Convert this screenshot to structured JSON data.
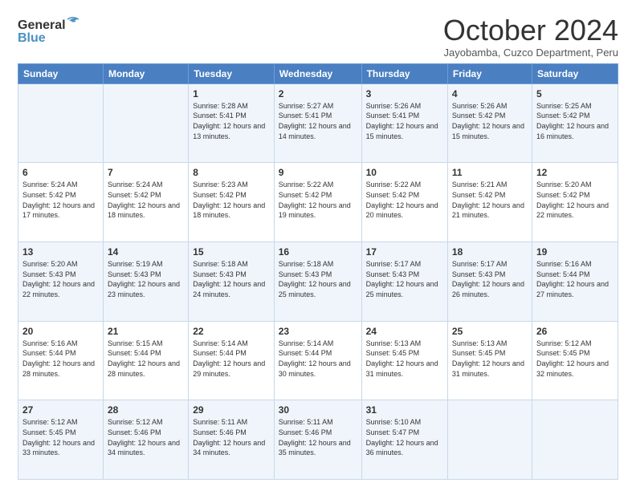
{
  "logo": {
    "line1": "General",
    "line2": "Blue"
  },
  "title": "October 2024",
  "location": "Jayobamba, Cuzco Department, Peru",
  "days_of_week": [
    "Sunday",
    "Monday",
    "Tuesday",
    "Wednesday",
    "Thursday",
    "Friday",
    "Saturday"
  ],
  "weeks": [
    [
      {
        "num": "",
        "info": ""
      },
      {
        "num": "",
        "info": ""
      },
      {
        "num": "1",
        "info": "Sunrise: 5:28 AM\nSunset: 5:41 PM\nDaylight: 12 hours and 13 minutes."
      },
      {
        "num": "2",
        "info": "Sunrise: 5:27 AM\nSunset: 5:41 PM\nDaylight: 12 hours and 14 minutes."
      },
      {
        "num": "3",
        "info": "Sunrise: 5:26 AM\nSunset: 5:41 PM\nDaylight: 12 hours and 15 minutes."
      },
      {
        "num": "4",
        "info": "Sunrise: 5:26 AM\nSunset: 5:42 PM\nDaylight: 12 hours and 15 minutes."
      },
      {
        "num": "5",
        "info": "Sunrise: 5:25 AM\nSunset: 5:42 PM\nDaylight: 12 hours and 16 minutes."
      }
    ],
    [
      {
        "num": "6",
        "info": "Sunrise: 5:24 AM\nSunset: 5:42 PM\nDaylight: 12 hours and 17 minutes."
      },
      {
        "num": "7",
        "info": "Sunrise: 5:24 AM\nSunset: 5:42 PM\nDaylight: 12 hours and 18 minutes."
      },
      {
        "num": "8",
        "info": "Sunrise: 5:23 AM\nSunset: 5:42 PM\nDaylight: 12 hours and 18 minutes."
      },
      {
        "num": "9",
        "info": "Sunrise: 5:22 AM\nSunset: 5:42 PM\nDaylight: 12 hours and 19 minutes."
      },
      {
        "num": "10",
        "info": "Sunrise: 5:22 AM\nSunset: 5:42 PM\nDaylight: 12 hours and 20 minutes."
      },
      {
        "num": "11",
        "info": "Sunrise: 5:21 AM\nSunset: 5:42 PM\nDaylight: 12 hours and 21 minutes."
      },
      {
        "num": "12",
        "info": "Sunrise: 5:20 AM\nSunset: 5:42 PM\nDaylight: 12 hours and 22 minutes."
      }
    ],
    [
      {
        "num": "13",
        "info": "Sunrise: 5:20 AM\nSunset: 5:43 PM\nDaylight: 12 hours and 22 minutes."
      },
      {
        "num": "14",
        "info": "Sunrise: 5:19 AM\nSunset: 5:43 PM\nDaylight: 12 hours and 23 minutes."
      },
      {
        "num": "15",
        "info": "Sunrise: 5:18 AM\nSunset: 5:43 PM\nDaylight: 12 hours and 24 minutes."
      },
      {
        "num": "16",
        "info": "Sunrise: 5:18 AM\nSunset: 5:43 PM\nDaylight: 12 hours and 25 minutes."
      },
      {
        "num": "17",
        "info": "Sunrise: 5:17 AM\nSunset: 5:43 PM\nDaylight: 12 hours and 25 minutes."
      },
      {
        "num": "18",
        "info": "Sunrise: 5:17 AM\nSunset: 5:43 PM\nDaylight: 12 hours and 26 minutes."
      },
      {
        "num": "19",
        "info": "Sunrise: 5:16 AM\nSunset: 5:44 PM\nDaylight: 12 hours and 27 minutes."
      }
    ],
    [
      {
        "num": "20",
        "info": "Sunrise: 5:16 AM\nSunset: 5:44 PM\nDaylight: 12 hours and 28 minutes."
      },
      {
        "num": "21",
        "info": "Sunrise: 5:15 AM\nSunset: 5:44 PM\nDaylight: 12 hours and 28 minutes."
      },
      {
        "num": "22",
        "info": "Sunrise: 5:14 AM\nSunset: 5:44 PM\nDaylight: 12 hours and 29 minutes."
      },
      {
        "num": "23",
        "info": "Sunrise: 5:14 AM\nSunset: 5:44 PM\nDaylight: 12 hours and 30 minutes."
      },
      {
        "num": "24",
        "info": "Sunrise: 5:13 AM\nSunset: 5:45 PM\nDaylight: 12 hours and 31 minutes."
      },
      {
        "num": "25",
        "info": "Sunrise: 5:13 AM\nSunset: 5:45 PM\nDaylight: 12 hours and 31 minutes."
      },
      {
        "num": "26",
        "info": "Sunrise: 5:12 AM\nSunset: 5:45 PM\nDaylight: 12 hours and 32 minutes."
      }
    ],
    [
      {
        "num": "27",
        "info": "Sunrise: 5:12 AM\nSunset: 5:45 PM\nDaylight: 12 hours and 33 minutes."
      },
      {
        "num": "28",
        "info": "Sunrise: 5:12 AM\nSunset: 5:46 PM\nDaylight: 12 hours and 34 minutes."
      },
      {
        "num": "29",
        "info": "Sunrise: 5:11 AM\nSunset: 5:46 PM\nDaylight: 12 hours and 34 minutes."
      },
      {
        "num": "30",
        "info": "Sunrise: 5:11 AM\nSunset: 5:46 PM\nDaylight: 12 hours and 35 minutes."
      },
      {
        "num": "31",
        "info": "Sunrise: 5:10 AM\nSunset: 5:47 PM\nDaylight: 12 hours and 36 minutes."
      },
      {
        "num": "",
        "info": ""
      },
      {
        "num": "",
        "info": ""
      }
    ]
  ]
}
